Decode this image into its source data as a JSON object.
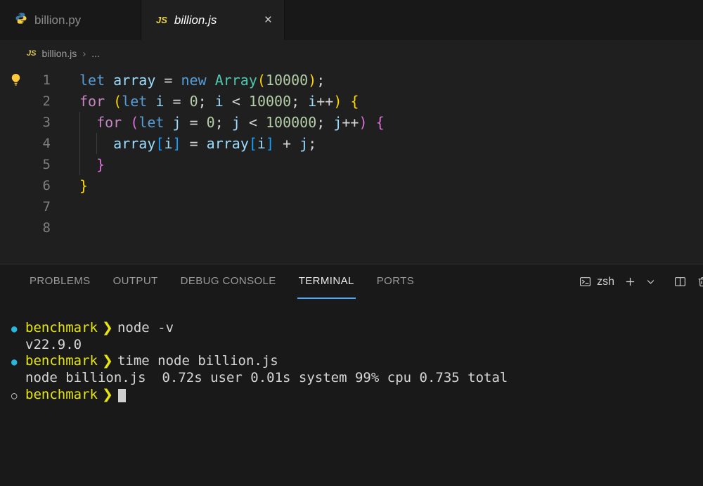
{
  "colors": {
    "panel_accent": "#4daafc",
    "lightbulb": "#ffc83d",
    "syntax": {
      "keyword": "#569cd6",
      "control": "#c586c0",
      "variable": "#9cdcfe",
      "type": "#4ec9b0",
      "number": "#b5cea8",
      "operator": "#d4d4d4",
      "bracket1": "#ffd700",
      "bracket2": "#da70d6",
      "bracket3": "#179fff"
    },
    "terminal": {
      "bullet_filled": "#29b8db",
      "bullet_hollow": "#c8c8c8",
      "prompt_dir": "#e5e510",
      "text": "#d6d6d6"
    }
  },
  "tabs": [
    {
      "label": "billion.py",
      "icon": "python",
      "active": false
    },
    {
      "label": "billion.js",
      "icon": "js",
      "active": true
    }
  ],
  "tab_close_label": "×",
  "breadcrumb": {
    "icon": "js",
    "file": "billion.js",
    "separator": "›",
    "more": "..."
  },
  "editor": {
    "lines": [
      {
        "num": 1,
        "tokens": [
          [
            "let ",
            "kw"
          ],
          [
            "array ",
            "vr"
          ],
          [
            "= ",
            "op"
          ],
          [
            "new ",
            "kw"
          ],
          [
            "Array",
            "ty"
          ],
          [
            "(",
            "b1"
          ],
          [
            "10000",
            "nu"
          ],
          [
            ")",
            "b1"
          ],
          [
            ";",
            "op"
          ]
        ]
      },
      {
        "num": 2,
        "tokens": [
          [
            "for ",
            "ct"
          ],
          [
            "(",
            "b1"
          ],
          [
            "let ",
            "kw"
          ],
          [
            "i ",
            "vr"
          ],
          [
            "= ",
            "op"
          ],
          [
            "0",
            "nu"
          ],
          [
            "; ",
            "op"
          ],
          [
            "i ",
            "vr"
          ],
          [
            "< ",
            "op"
          ],
          [
            "10000",
            "nu"
          ],
          [
            "; ",
            "op"
          ],
          [
            "i",
            "vr"
          ],
          [
            "++",
            "op"
          ],
          [
            ")",
            "b1"
          ],
          [
            " {",
            "b1"
          ]
        ]
      },
      {
        "num": 3,
        "guides": [
          0
        ],
        "tokens": [
          [
            "  ",
            "pl"
          ],
          [
            "for ",
            "ct"
          ],
          [
            "(",
            "b2"
          ],
          [
            "let ",
            "kw"
          ],
          [
            "j ",
            "vr"
          ],
          [
            "= ",
            "op"
          ],
          [
            "0",
            "nu"
          ],
          [
            "; ",
            "op"
          ],
          [
            "j ",
            "vr"
          ],
          [
            "< ",
            "op"
          ],
          [
            "100000",
            "nu"
          ],
          [
            "; ",
            "op"
          ],
          [
            "j",
            "vr"
          ],
          [
            "++",
            "op"
          ],
          [
            ")",
            "b2"
          ],
          [
            " {",
            "b2"
          ]
        ]
      },
      {
        "num": 4,
        "guides": [
          0,
          2
        ],
        "tokens": [
          [
            "    ",
            "pl"
          ],
          [
            "array",
            "vr"
          ],
          [
            "[",
            "b3"
          ],
          [
            "i",
            "vr"
          ],
          [
            "]",
            "b3"
          ],
          [
            " = ",
            "op"
          ],
          [
            "array",
            "vr"
          ],
          [
            "[",
            "b3"
          ],
          [
            "i",
            "vr"
          ],
          [
            "]",
            "b3"
          ],
          [
            " + ",
            "op"
          ],
          [
            "j",
            "vr"
          ],
          [
            ";",
            "op"
          ]
        ]
      },
      {
        "num": 5,
        "guides": [
          0
        ],
        "tokens": [
          [
            "  ",
            "pl"
          ],
          [
            "}",
            "b2"
          ]
        ]
      },
      {
        "num": 6,
        "tokens": [
          [
            "}",
            "b1"
          ]
        ]
      },
      {
        "num": 7,
        "tokens": []
      },
      {
        "num": 8,
        "tokens": []
      }
    ]
  },
  "panel": {
    "tabs": [
      {
        "label": "PROBLEMS",
        "active": false
      },
      {
        "label": "OUTPUT",
        "active": false
      },
      {
        "label": "DEBUG CONSOLE",
        "active": false
      },
      {
        "label": "TERMINAL",
        "active": true
      },
      {
        "label": "PORTS",
        "active": false
      }
    ],
    "shell_label": "zsh"
  },
  "terminal": {
    "lines": [
      {
        "kind": "prompt",
        "bullet": "filled",
        "dir": "benchmark",
        "arrow": "❯",
        "command": "node -v"
      },
      {
        "kind": "output",
        "text": "v22.9.0"
      },
      {
        "kind": "prompt",
        "bullet": "filled",
        "dir": "benchmark",
        "arrow": "❯",
        "command": "time node billion.js"
      },
      {
        "kind": "output",
        "text": "node billion.js  0.72s user 0.01s system 99% cpu 0.735 total"
      },
      {
        "kind": "prompt",
        "bullet": "hollow",
        "dir": "benchmark",
        "arrow": "❯",
        "command": "",
        "cursor": true
      }
    ]
  }
}
